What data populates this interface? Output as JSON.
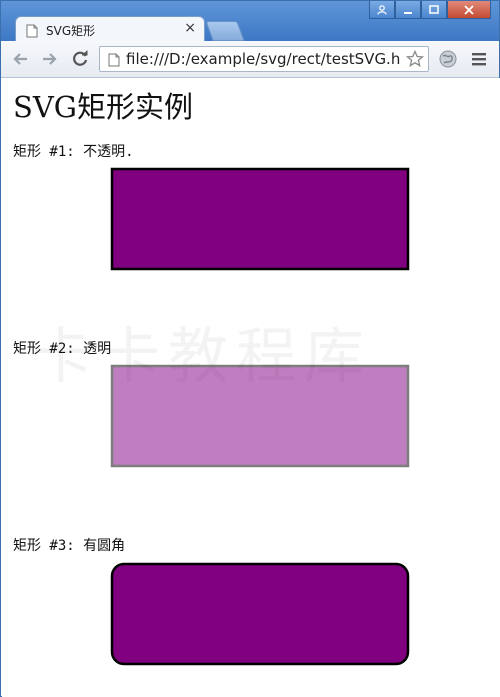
{
  "window": {
    "controls": [
      "user-icon",
      "minimize-icon",
      "maximize-icon",
      "close-icon"
    ]
  },
  "tab": {
    "title": "SVG矩形",
    "close_label": "×"
  },
  "toolbar": {
    "url": "file:///D:/example/svg/rect/testSVG.h",
    "icons": [
      "back-arrow-icon",
      "forward-arrow-icon",
      "reload-icon",
      "page-icon",
      "star-icon",
      "globe-icon",
      "menu-icon"
    ]
  },
  "page": {
    "title": "SVG矩形实例",
    "watermark": "卡卡教程库",
    "examples": [
      {
        "label": "矩形 #1: 不透明.",
        "fill": "#800080",
        "stroke": "#000000",
        "opacity": 1.0,
        "rounded": false
      },
      {
        "label": "矩形 #2: 透明",
        "fill": "#800080",
        "stroke": "#000000",
        "opacity": 0.5,
        "rounded": false
      },
      {
        "label": "矩形 #3: 有圆角",
        "fill": "#800080",
        "stroke": "#000000",
        "opacity": 1.0,
        "rounded": true
      }
    ]
  },
  "colors": {
    "title_bar": "#3e78c4",
    "rect_fill": "#800080"
  }
}
